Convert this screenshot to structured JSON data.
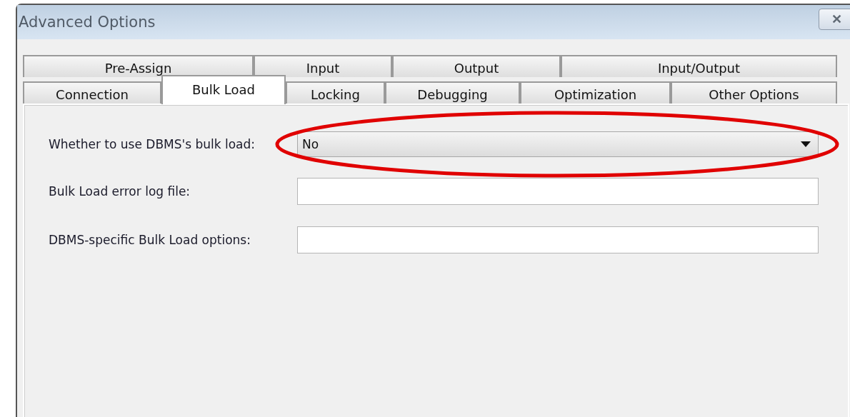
{
  "window": {
    "title": "Advanced Options",
    "close": "✕"
  },
  "tab_rows": [
    [
      {
        "label": "Pre-Assign",
        "selected": false
      },
      {
        "label": "Input",
        "selected": false
      },
      {
        "label": "Output",
        "selected": false
      },
      {
        "label": "Input/Output",
        "selected": false
      }
    ],
    [
      {
        "label": "Connection",
        "selected": false
      },
      {
        "label": "Bulk Load",
        "selected": true
      },
      {
        "label": "Locking",
        "selected": false
      },
      {
        "label": "Debugging",
        "selected": false
      },
      {
        "label": "Optimization",
        "selected": false
      },
      {
        "label": "Other Options",
        "selected": false
      }
    ]
  ],
  "fields": [
    {
      "kind": "dropdown",
      "label": "Whether to use DBMS's bulk load:",
      "value": "No",
      "highlighted": true
    },
    {
      "kind": "text",
      "label": "Bulk Load error log file:",
      "highlighted": false
    },
    {
      "kind": "text",
      "label": "DBMS-specific Bulk Load options:",
      "highlighted": false
    }
  ]
}
